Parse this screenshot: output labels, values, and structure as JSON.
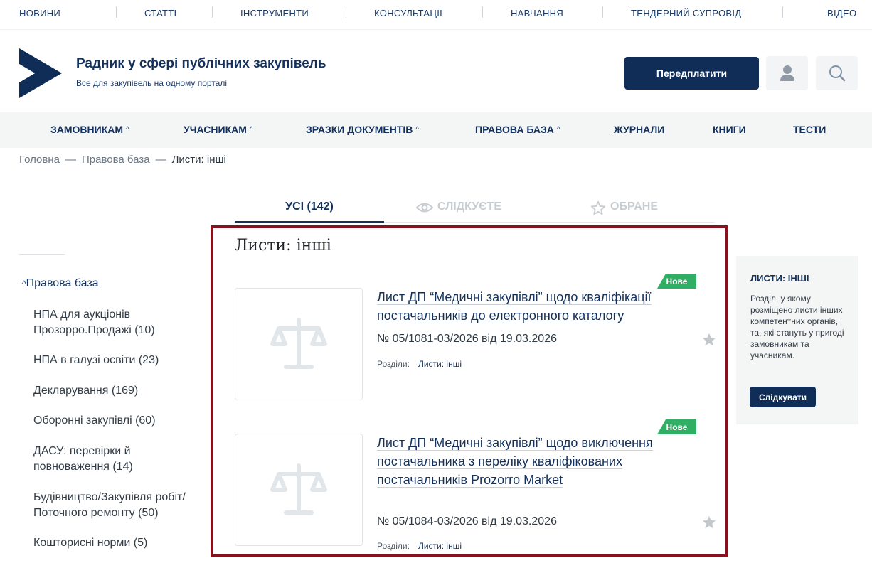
{
  "top_links": [
    "НОВИНИ",
    "СТАТТІ",
    "ІНСТРУМЕНТИ",
    "КОНСУЛЬТАЦІЇ",
    "НАВЧАННЯ",
    "ТЕНДЕРНИЙ СУПРОВІД",
    "ВІДЕО"
  ],
  "header": {
    "title": "Радник у сфері публічних закупівель",
    "subtitle": "Все для закупівель на одному порталі",
    "subscribe_label": "Передплатити",
    "user_icon": "user-icon",
    "search_icon": "search-icon"
  },
  "main_nav": [
    {
      "label": "ЗАМОВНИКАМ",
      "caret": "^"
    },
    {
      "label": "УЧАСНИКАМ",
      "caret": "^"
    },
    {
      "label": "ЗРАЗКИ ДОКУМЕНТІВ",
      "caret": "^"
    },
    {
      "label": "ПРАВОВА БАЗА",
      "caret": "^"
    },
    {
      "label": "ЖУРНАЛИ"
    },
    {
      "label": "КНИГИ"
    },
    {
      "label": "ТЕСТИ"
    }
  ],
  "breadcrumb": {
    "home": "Головна",
    "section": "Правова база",
    "current": "Листи: інші",
    "separator": "—"
  },
  "tabs": {
    "all": "УСІ (142)",
    "following": "СЛІДКУЄТЕ",
    "favorites": "ОБРАНЕ"
  },
  "sidebar": {
    "head": "Правова база",
    "items": [
      "НПА для аукціонів Прозорро.Продажі (10)",
      "НПА в галузі освіти (23)",
      "Декларування (169)",
      "Оборонні закупівлі (60)",
      "ДАСУ: перевірки й повноваження (14)",
      "Будівництво/Закупівля робіт/ Поточного ремонту (50)",
      "Кошторисні норми (5)"
    ]
  },
  "content": {
    "title": "Листи: інші",
    "docs": [
      {
        "badge": "Нове",
        "title": "Лист ДП “Медичні закупівлі” щодо кваліфікації постачальників до електронного каталогу",
        "number": "№ 05/1081-03/2026 від 19.03.2026",
        "sections_label": "Розділи:",
        "section": "Листи: інші"
      },
      {
        "badge": "Нове",
        "title": "Лист ДП “Медичні закупівлі” щодо виключення постачальника з переліку кваліфікованих постачальників Prozorro Market",
        "number": "№ 05/1084-03/2026 від 19.03.2026",
        "sections_label": "Розділи:",
        "section": "Листи: інші"
      }
    ]
  },
  "right_panel": {
    "title": "ЛИСТИ: ІНШІ",
    "text": "Розділ, у якому розміщено листи інших компетентних органів, та, які стануть у пригоді замовникам та учасникам.",
    "button": "Слідкувати"
  },
  "colors": {
    "primary": "#0f2d57",
    "badge": "#2fae64",
    "highlight_border": "#86121e"
  }
}
